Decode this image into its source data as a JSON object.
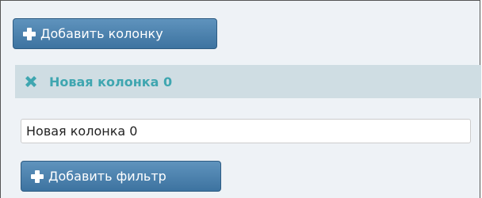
{
  "toolbar": {
    "add_column_label": "Добавить колонку",
    "add_column_icon": "plus-icon"
  },
  "column": {
    "title": "Новая колонка 0",
    "remove_icon": "close-icon",
    "title_color": "#3fa6b0",
    "name_value": "Новая колонка 0"
  },
  "filters": {
    "add_filter_label": "Добавить фильтр",
    "add_filter_icon": "plus-icon"
  },
  "colors": {
    "button_bg": "#4a80ac",
    "header_bg": "#cfdde3",
    "panel_bg": "#eef2f6"
  }
}
